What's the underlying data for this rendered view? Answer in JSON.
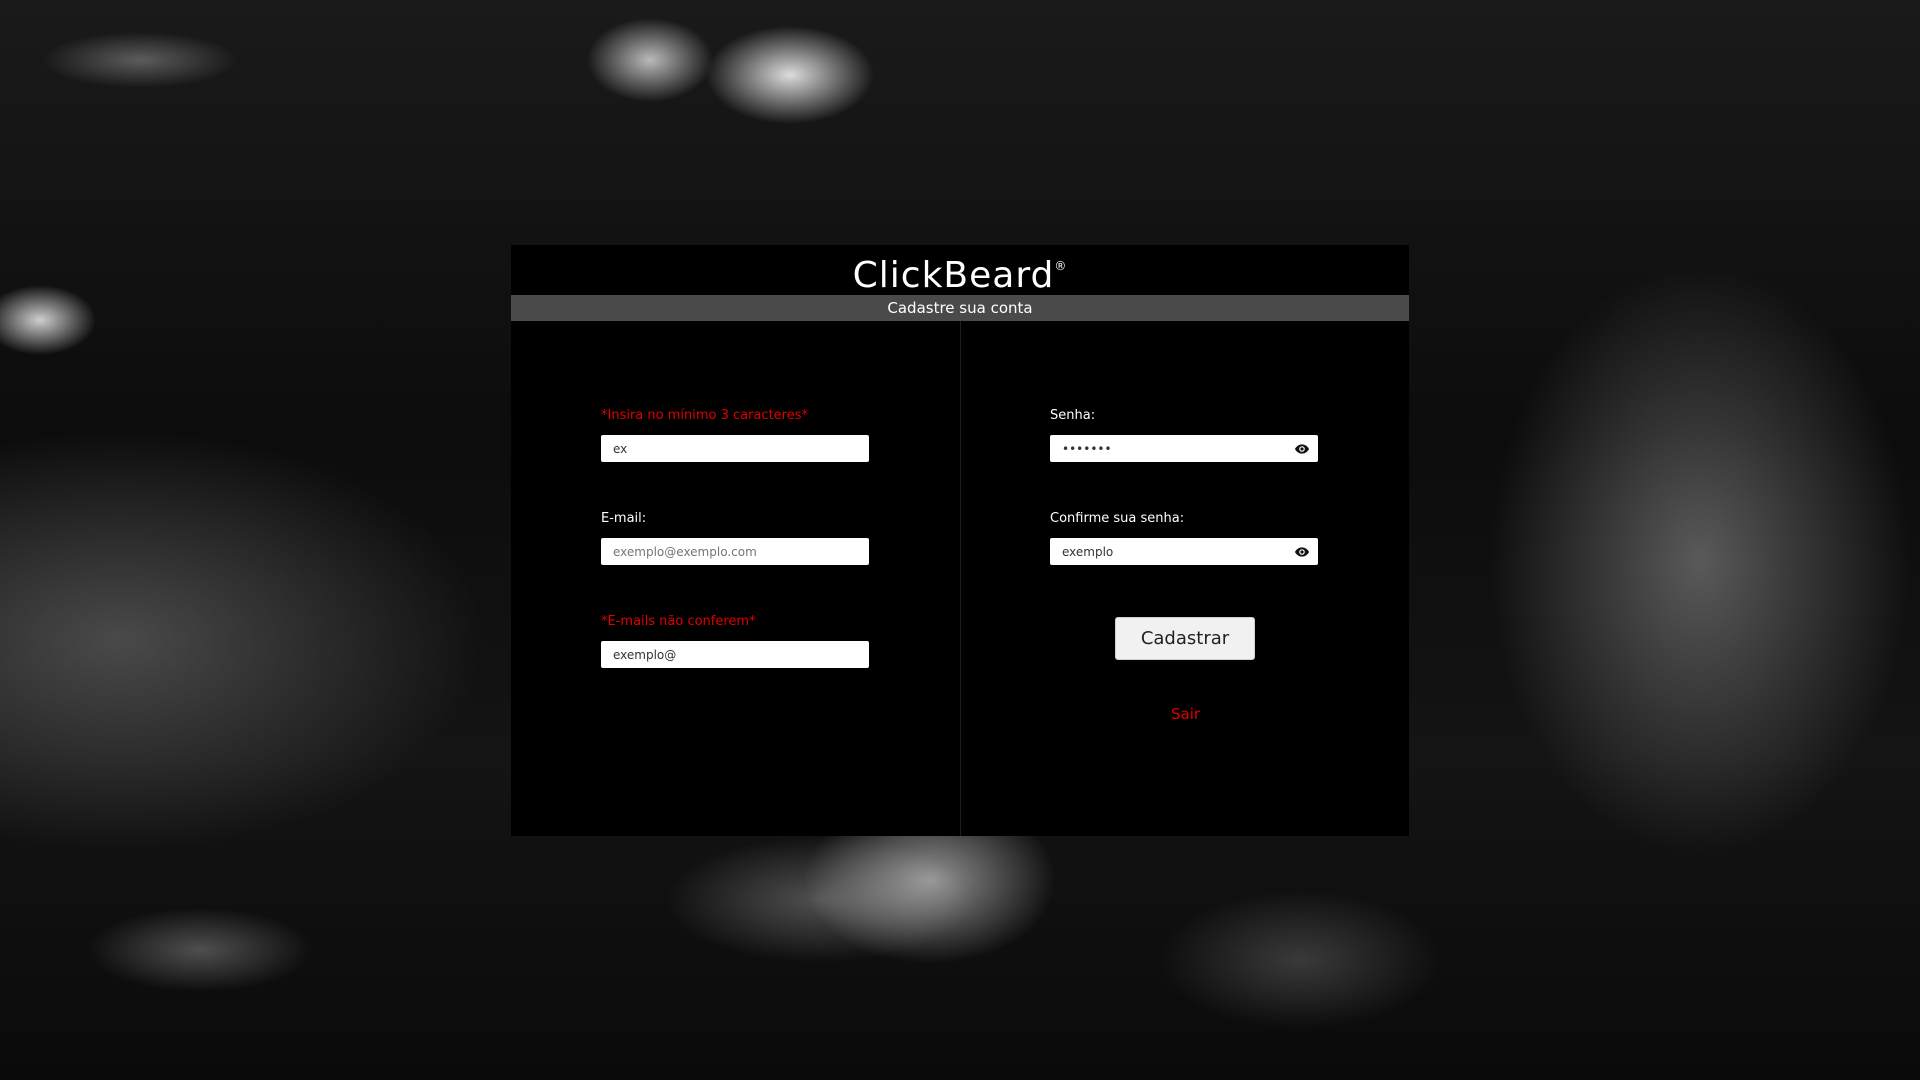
{
  "app": {
    "brand": "ClickBeard",
    "registered_mark": "®",
    "subtitle": "Cadastre sua conta"
  },
  "form": {
    "left": {
      "name_field": {
        "label": "*Insira no mínimo 3 caracteres*",
        "label_state": "error",
        "value": "ex"
      },
      "email_field": {
        "label": "E-mail:",
        "placeholder": "exemplo@exemplo.com",
        "value": ""
      },
      "confirm_email_field": {
        "label": "*E-mails não conferem*",
        "label_state": "error",
        "value": "exemplo@"
      }
    },
    "right": {
      "password_field": {
        "label": "Senha:",
        "value": "exemplo",
        "masked": true,
        "icon": "eye-icon"
      },
      "confirm_password_field": {
        "label": "Confirme sua senha:",
        "value": "exemplo",
        "masked": false,
        "icon": "eye-icon"
      },
      "submit_label": "Cadastrar",
      "exit_label": "Sair"
    }
  },
  "colors": {
    "error": "#e00000",
    "card_background": "#000000",
    "subtitle_bar": "#4a4a4a",
    "button_background": "#f1f1f1"
  }
}
